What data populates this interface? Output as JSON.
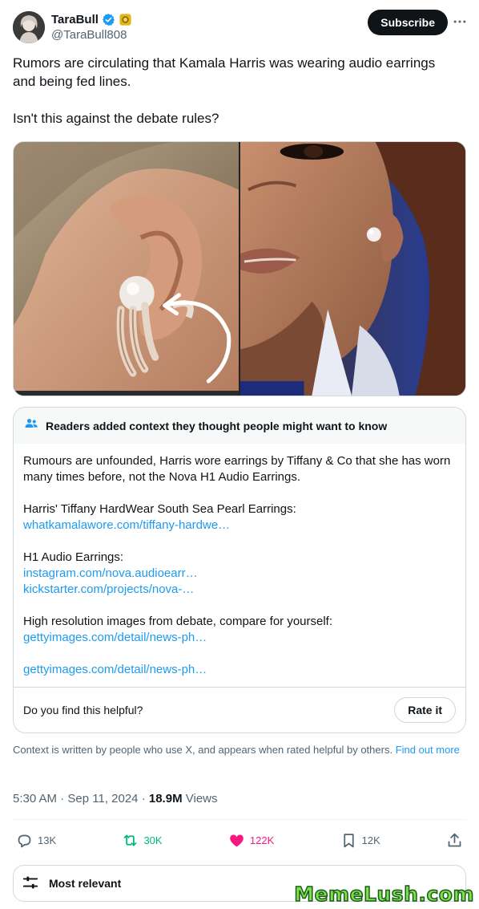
{
  "author": {
    "display_name": "TaraBull",
    "handle": "@TaraBull808",
    "avatar_icon": "avatar-photo",
    "verified_icon": "verified-badge-icon",
    "affiliate_icon": "gold-badge-icon"
  },
  "header": {
    "subscribe_label": "Subscribe",
    "more_icon": "more-horizontal-icon"
  },
  "tweet": {
    "paragraphs": [
      "Rumors are circulating that Kamala Harris was wearing audio earrings and being fed lines.",
      "Isn't this against the debate rules?"
    ]
  },
  "note": {
    "title": "Readers added context they thought people might want to know",
    "intro": "Rumours are unfounded, Harris wore earrings by Tiffany & Co that she has worn many times before, not the Nova H1 Audio Earrings.",
    "tiffany_label": "Harris' Tiffany HardWear South Sea Pearl Earrings:",
    "tiffany_link": "whatkamalawore.com/tiffany-hardwe…",
    "h1_label": "H1 Audio Earrings:",
    "h1_link_1": "instagram.com/nova.audioearr…",
    "h1_link_2": "kickstarter.com/projects/nova-…",
    "hires_label": "High resolution images from debate, compare for yourself:",
    "getty_link_1": "gettyimages.com/detail/news-ph…",
    "getty_link_2": "gettyimages.com/detail/news-ph…",
    "helpful_question": "Do you find this helpful?",
    "rate_label": "Rate it"
  },
  "disclaimer": {
    "text": "Context is written by people who use X, and appears when rated helpful by others.",
    "link": "Find out more"
  },
  "meta": {
    "time": "5:30 AM",
    "separator": "·",
    "date": "Sep 11, 2024",
    "views_count": "18.9M",
    "views_label": "Views"
  },
  "actions": {
    "replies": "13K",
    "reposts": "30K",
    "likes": "122K",
    "bookmarks": "12K"
  },
  "sort": {
    "label": "Most relevant"
  },
  "watermark": "MemeLush.com",
  "colors": {
    "accent": "#1d9bf0",
    "repost": "#00ba7c",
    "like": "#f91880",
    "text": "#0f1419",
    "secondary": "#536471"
  }
}
